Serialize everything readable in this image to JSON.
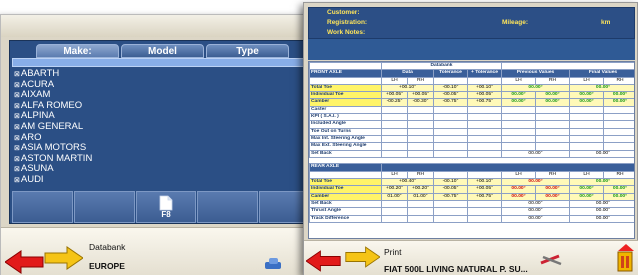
{
  "back_window": {
    "tabs": [
      "Make:",
      "Model",
      "Type"
    ],
    "makes": [
      "ABARTH",
      "ACURA",
      "AIXAM",
      "ALFA ROMEO",
      "ALPINA",
      "AM GENERAL",
      "ARO",
      "ASIA MOTORS",
      "ASTON MARTIN",
      "ASUNA",
      "AUDI"
    ],
    "f8_label": "F8",
    "bottom_title": "Databank",
    "bottom_region": "EUROPE"
  },
  "report": {
    "customer_label": "Customer:",
    "registration_label": "Registration:",
    "mileage_label": "Mileage:",
    "mileage_unit": "km",
    "work_notes_label": "Work Notes:",
    "databank_header": "Databank",
    "front_axle": "FRONT AXLE",
    "rear_axle": "REAR AXLE",
    "col_data": "Data",
    "col_tol_minus": "Tolerance",
    "col_tol_plus": "+ Tolerance",
    "col_prev": "Previous Values",
    "col_final": "Final Values",
    "lh": "LH",
    "rh": "RH",
    "front_rows": [
      {
        "label": "Total Toe",
        "data": "+00.10°",
        "tm": "-00.10°",
        "tp": "+00.10°",
        "prev_lh": "00.00°",
        "fin_lh": "00.00°"
      },
      {
        "label": "Individual Toe",
        "data_lh": "+00.05°",
        "data_rh": "+00.05°",
        "tm": "-00.05°",
        "tp": "+00.05°",
        "prev_lh": "00.00°",
        "prev_rh": "00.00°",
        "fin_lh": "00.00°",
        "fin_rh": "00.00°"
      },
      {
        "label": "Camber",
        "data_lh": "-00.25°",
        "data_rh": "-00.30°",
        "tm": "-00.75°",
        "tp": "+00.75°",
        "prev_lh": "00.00°",
        "prev_rh": "00.00°",
        "fin_lh": "00.00°",
        "fin_rh": "00.00°"
      },
      {
        "label": "Caster"
      },
      {
        "label": "KPI ( S.A.I. )"
      },
      {
        "label": "Included Angle"
      },
      {
        "label": "Toe Out on Turns"
      },
      {
        "label": "Max Int. Steering Angle"
      },
      {
        "label": "Max Ext. Steering Angle"
      },
      {
        "label": "Set Back",
        "prev_mid": "00.00°",
        "fin_mid": "00.00°"
      }
    ],
    "rear_rows": [
      {
        "label": "Total Toe",
        "data": "+00.40°",
        "tm": "-00.10°",
        "tp": "+00.10°",
        "prev_lh": "00.00°",
        "fin_lh": "00.00°"
      },
      {
        "label": "Individual Toe",
        "data_lh": "+00.20°",
        "data_rh": "+00.20°",
        "tm": "-00.05°",
        "tp": "+00.05°",
        "prev_lh": "00.00°",
        "prev_rh": "00.00°",
        "fin_lh": "00.00°",
        "fin_rh": "00.00°"
      },
      {
        "label": "Camber",
        "data_lh": "01.00°",
        "data_rh": "01.00°",
        "tm": "-00.75°",
        "tp": "+00.75°",
        "prev_lh": "00.00°",
        "prev_rh": "00.00°",
        "fin_lh": "00.00°",
        "fin_rh": "00.00°"
      },
      {
        "label": "Set Back",
        "prev_mid": "00.00°",
        "fin_mid": "00.00°"
      },
      {
        "label": "Thrust Angle",
        "prev_mid": "00.00°",
        "fin_mid": "00.00°"
      },
      {
        "label": "Track Difference",
        "prev_mid": "00.00°",
        "fin_mid": "00.00°"
      }
    ],
    "bottom_title": "Print",
    "bottom_vehicle": "FIAT 500L LIVING NATURAL P. SU..."
  }
}
